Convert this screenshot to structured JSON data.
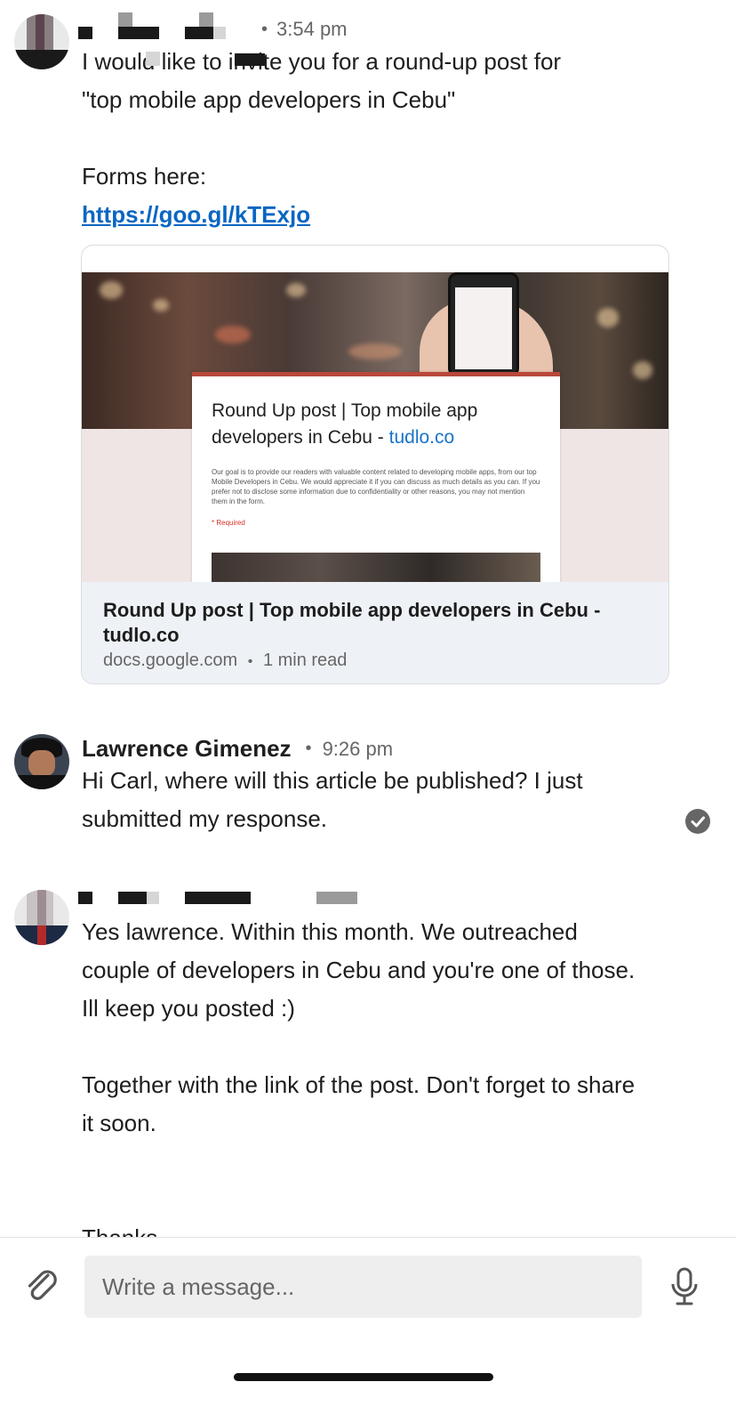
{
  "messages": [
    {
      "sender": "",
      "time": "3:54 pm",
      "lines_top": "I would like to invite you for a round-up post for",
      "line2": "\"top mobile app developers in Cebu\"",
      "forms_label": "Forms here:",
      "link": "https://goo.gl/kTExjo",
      "preview": {
        "form_title": "Round Up post | Top mobile app developers in Cebu - ",
        "form_title_site": "tudlo.co",
        "form_desc": "Our goal is to provide our readers with valuable content related to developing mobile apps, from our top Mobile Developers in Cebu. We would appreciate it if you can discuss as much details as you can. If you prefer not to disclose some information due to confidentiality or other reasons, you may not mention them in the form.",
        "form_required": "* Required",
        "title": "Round Up post | Top mobile app developers in Cebu - tudlo.co",
        "domain": "docs.google.com",
        "read_time": "1 min read"
      }
    },
    {
      "sender": "Lawrence Gimenez",
      "time": "9:26 pm",
      "text": "Hi Carl, where will this article be published? I just submitted my response.",
      "status_icon": "check-circle-icon"
    },
    {
      "sender": "",
      "time": "",
      "para1": "Yes lawrence.  Within this month.  We outreached couple of developers in Cebu and you're one of those.  Ill keep you posted :)",
      "para2": "Together with the link of the post.  Don't forget to share it soon.",
      "para3": "Thanks"
    }
  ],
  "separator": "•",
  "composer": {
    "placeholder": "Write a message...",
    "attach_icon": "paperclip-icon",
    "mic_icon": "microphone-icon"
  },
  "colors": {
    "link": "#0a66c2",
    "card_footer": "#eef2f7",
    "composer_input": "#eeeeee"
  }
}
